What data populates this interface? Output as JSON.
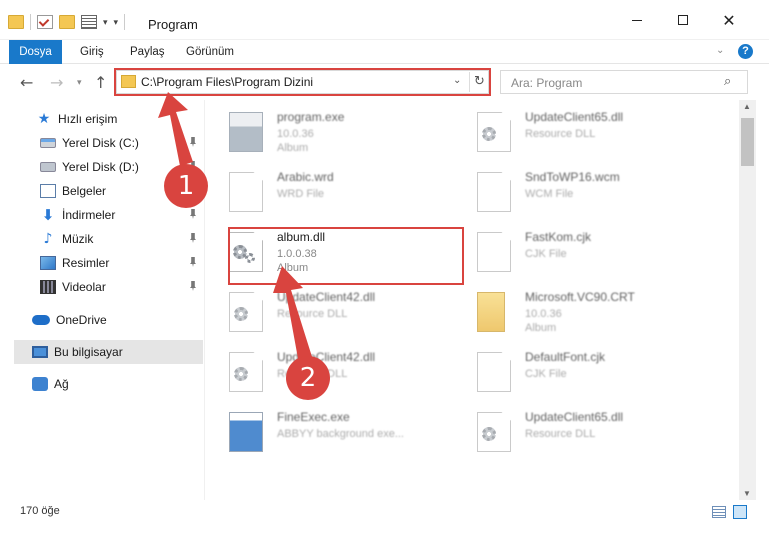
{
  "window": {
    "title": "Program"
  },
  "ribbon": {
    "tabs": [
      {
        "label": "Dosya"
      },
      {
        "label": "Giriş"
      },
      {
        "label": "Paylaş"
      },
      {
        "label": "Görünüm"
      }
    ],
    "help_glyph": "?"
  },
  "nav": {
    "address": "C:\\Program Files\\Program Dizini",
    "search_placeholder": "Ara: Program"
  },
  "sidebar": {
    "items": [
      {
        "label": "Hızlı erişim",
        "icon": "star-icon"
      },
      {
        "label": "Yerel Disk (C:)",
        "icon": "drive-icon"
      },
      {
        "label": "Yerel Disk (D:)",
        "icon": "drive-icon"
      },
      {
        "label": "Belgeler",
        "icon": "documents-icon"
      },
      {
        "label": "İndirmeler",
        "icon": "download-icon"
      },
      {
        "label": "Müzik",
        "icon": "music-icon"
      },
      {
        "label": "Resimler",
        "icon": "pictures-icon"
      },
      {
        "label": "Videolar",
        "icon": "video-icon"
      },
      {
        "label": "OneDrive",
        "icon": "cloud-icon"
      },
      {
        "label": "Bu bilgisayar",
        "icon": "computer-icon"
      },
      {
        "label": "Ağ",
        "icon": "network-icon"
      }
    ]
  },
  "files": {
    "left": [
      {
        "name": "program.exe",
        "line2": "10.0.36",
        "line3": "Album",
        "icon": "exe-icon"
      },
      {
        "name": "Arabic.wrd",
        "line2": "WRD File",
        "line3": "",
        "icon": "file-icon"
      },
      {
        "name": "album.dll",
        "line2": "1.0.0.38",
        "line3": "Album",
        "icon": "dll-gear-icon"
      },
      {
        "name": "UpdateClient42.dll",
        "line2": "Resource DLL",
        "line3": "",
        "icon": "dll-gear-icon"
      },
      {
        "name": "UpdateClient42.dll",
        "line2": "Resource DLL",
        "line3": "",
        "icon": "dll-gear-icon"
      },
      {
        "name": "FineExec.exe",
        "line2": "ABBYY background exe...",
        "line3": "",
        "icon": "exe-blue-icon"
      }
    ],
    "right": [
      {
        "name": "UpdateClient65.dll",
        "line2": "Resource DLL",
        "line3": "",
        "icon": "dll-gear-icon"
      },
      {
        "name": "SndToWP16.wcm",
        "line2": "WCM File",
        "line3": "",
        "icon": "file-icon"
      },
      {
        "name": "FastKom.cjk",
        "line2": "CJK File",
        "line3": "",
        "icon": "file-icon"
      },
      {
        "name": "Microsoft.VC90.CRT",
        "line2": "10.0.36",
        "line3": "Album",
        "icon": "folder-icon"
      },
      {
        "name": "DefaultFont.cjk",
        "line2": "CJK File",
        "line3": "",
        "icon": "file-icon"
      },
      {
        "name": "UpdateClient65.dll",
        "line2": "Resource DLL",
        "line3": "",
        "icon": "dll-gear-icon"
      }
    ]
  },
  "annotations": {
    "step1": "1",
    "step2": "2",
    "color": "#d9443f"
  },
  "status": {
    "count": "170 öğe"
  },
  "colors": {
    "accent": "#1979ca",
    "highlight": "#d9443f"
  }
}
